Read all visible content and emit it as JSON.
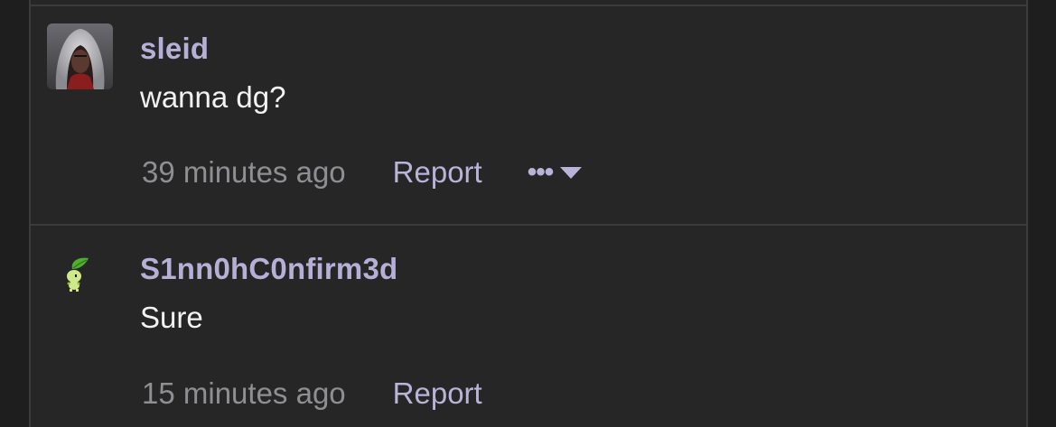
{
  "comments": [
    {
      "username": "sleid",
      "body": "wanna dg?",
      "time": "39 minutes ago",
      "report_label": "Report",
      "more_label": "•••",
      "avatar_icon": "hooded-figure-avatar"
    },
    {
      "username": "S1nn0hC0nfirm3d",
      "body": "Sure",
      "time": "15 minutes ago",
      "report_label": "Report",
      "avatar_icon": "chikorita-sprite-avatar"
    }
  ],
  "colors": {
    "background": "#1e1e1e",
    "card": "#262626",
    "border": "#3b3b3b",
    "username": "#b6b0d6",
    "body_text": "#f2f2f2",
    "timestamp": "#8f8f93",
    "link": "#b9b3d8"
  }
}
